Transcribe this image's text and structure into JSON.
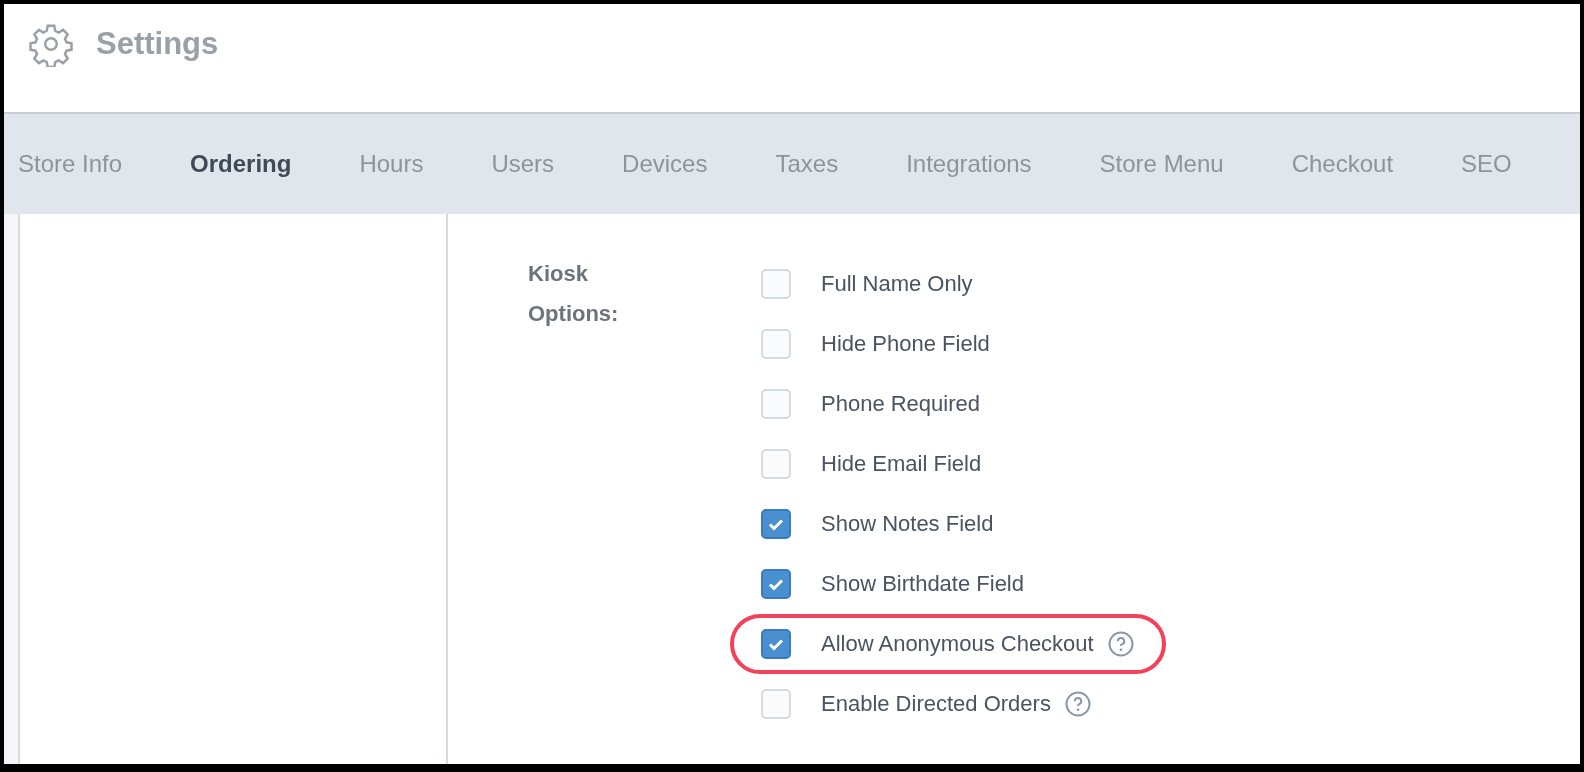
{
  "header": {
    "title": "Settings"
  },
  "tabs": [
    {
      "label": "Store Info",
      "selected": false
    },
    {
      "label": "Ordering",
      "selected": true
    },
    {
      "label": "Hours",
      "selected": false
    },
    {
      "label": "Users",
      "selected": false
    },
    {
      "label": "Devices",
      "selected": false
    },
    {
      "label": "Taxes",
      "selected": false
    },
    {
      "label": "Integrations",
      "selected": false
    },
    {
      "label": "Store Menu",
      "selected": false
    },
    {
      "label": "Checkout",
      "selected": false
    },
    {
      "label": "SEO",
      "selected": false
    }
  ],
  "kiosk_options": {
    "label": "Kiosk Options:",
    "options": [
      {
        "label": "Full Name Only",
        "checked": false,
        "help": false,
        "highlighted": false
      },
      {
        "label": "Hide Phone Field",
        "checked": false,
        "help": false,
        "highlighted": false
      },
      {
        "label": "Phone Required",
        "checked": false,
        "help": false,
        "highlighted": false
      },
      {
        "label": "Hide Email Field",
        "checked": false,
        "help": false,
        "highlighted": false
      },
      {
        "label": "Show Notes Field",
        "checked": true,
        "help": false,
        "highlighted": false
      },
      {
        "label": "Show Birthdate Field",
        "checked": true,
        "help": false,
        "highlighted": false
      },
      {
        "label": "Allow Anonymous Checkout",
        "checked": true,
        "help": true,
        "highlighted": true
      },
      {
        "label": "Enable Directed Orders",
        "checked": false,
        "help": true,
        "highlighted": false
      }
    ]
  }
}
